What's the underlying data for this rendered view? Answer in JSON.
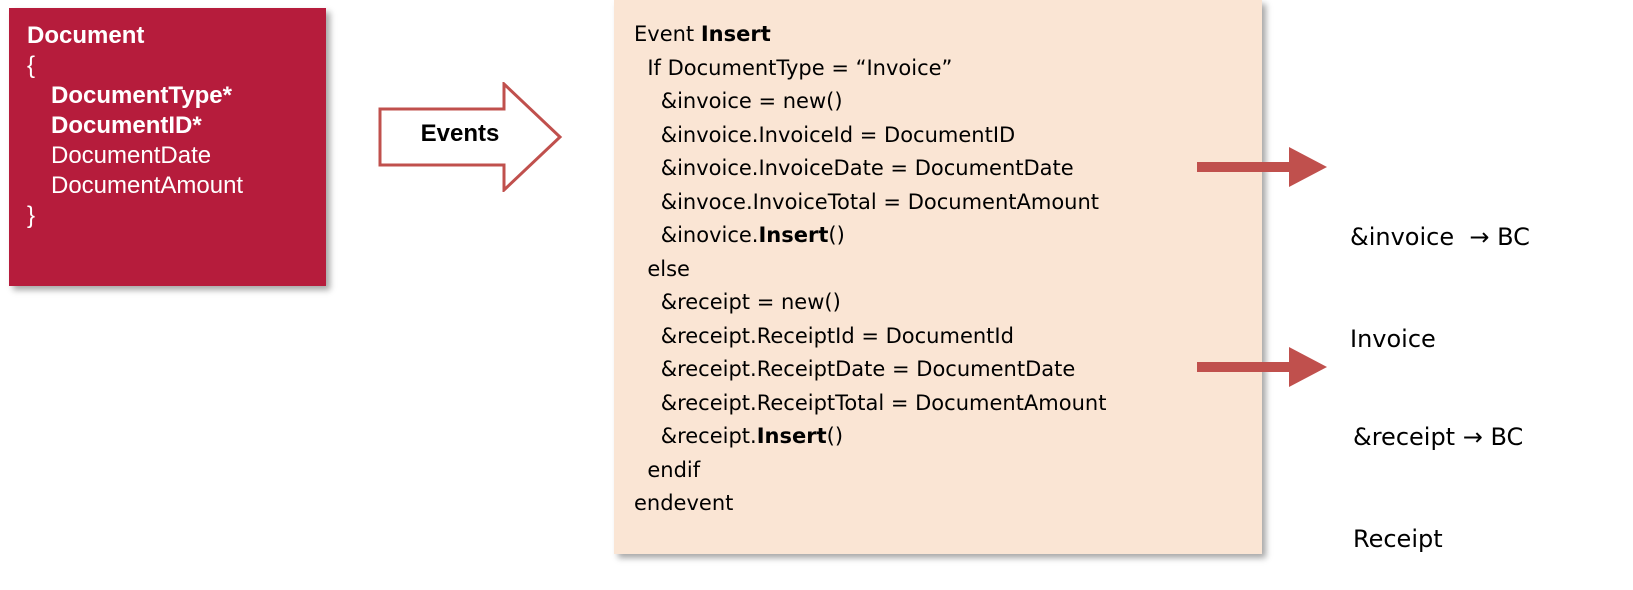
{
  "document": {
    "title": "Document",
    "open_brace": "{",
    "key_attrs": [
      "DocumentType*",
      "DocumentID*"
    ],
    "attrs": [
      "DocumentDate",
      "DocumentAmount"
    ],
    "close_brace": "}"
  },
  "events_arrow": {
    "label": "Events"
  },
  "code": {
    "lines": [
      {
        "pre": "Event ",
        "bold": "Insert",
        "post": ""
      },
      {
        "pre": "  If DocumentType = “Invoice”",
        "bold": "",
        "post": ""
      },
      {
        "pre": "    &invoice = new()",
        "bold": "",
        "post": ""
      },
      {
        "pre": "    &invoice.InvoiceId = DocumentID",
        "bold": "",
        "post": ""
      },
      {
        "pre": "    &invoice.InvoiceDate = DocumentDate",
        "bold": "",
        "post": ""
      },
      {
        "pre": "    &invoce.InvoiceTotal = DocumentAmount",
        "bold": "",
        "post": ""
      },
      {
        "pre": "    &inovice.",
        "bold": "Insert",
        "post": "()"
      },
      {
        "pre": "  else",
        "bold": "",
        "post": ""
      },
      {
        "pre": "    &receipt = new()",
        "bold": "",
        "post": ""
      },
      {
        "pre": "    &receipt.ReceiptId = DocumentId",
        "bold": "",
        "post": ""
      },
      {
        "pre": "    &receipt.ReceiptDate = DocumentDate",
        "bold": "",
        "post": ""
      },
      {
        "pre": "    &receipt.ReceiptTotal = DocumentAmount",
        "bold": "",
        "post": ""
      },
      {
        "pre": "    &receipt.",
        "bold": "Insert",
        "post": "()"
      },
      {
        "pre": "  endif",
        "bold": "",
        "post": ""
      },
      {
        "pre": "endevent",
        "bold": "",
        "post": ""
      }
    ]
  },
  "bc_invoice": {
    "line1": "&invoice  → BC",
    "line2": "Invoice"
  },
  "bc_receipt": {
    "line1": "&receipt → BC",
    "line2": "Receipt"
  },
  "colors": {
    "document_fill": "#b61c3c",
    "code_fill": "#fae5d4",
    "arrow_red": "#c0504d"
  }
}
